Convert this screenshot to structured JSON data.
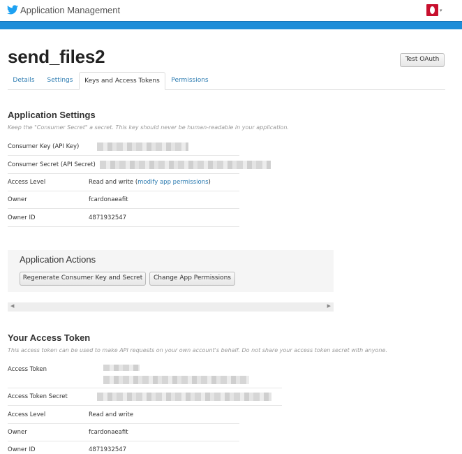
{
  "header": {
    "app_title": "Application Management",
    "logo_icon": "twitter-bird-icon",
    "avatar_icon": "user-avatar-icon",
    "caret": "▾"
  },
  "page": {
    "title": "send_files2",
    "test_oauth_label": "Test OAuth"
  },
  "tabs": [
    {
      "label": "Details",
      "active": false
    },
    {
      "label": "Settings",
      "active": false
    },
    {
      "label": "Keys and Access Tokens",
      "active": true
    },
    {
      "label": "Permissions",
      "active": false
    }
  ],
  "app_settings": {
    "heading": "Application Settings",
    "note": "Keep the \"Consumer Secret\" a secret. This key should never be human-readable in your application.",
    "rows": {
      "consumer_key": {
        "label": "Consumer Key (API Key)"
      },
      "consumer_secret": {
        "label": "Consumer Secret (API Secret)"
      },
      "access_level": {
        "label": "Access Level",
        "value_prefix": "Read and write (",
        "link": "modify app permissions",
        "value_suffix": ")"
      },
      "owner": {
        "label": "Owner",
        "value": "fcardonaeafit"
      },
      "owner_id": {
        "label": "Owner ID",
        "value": "4871932547"
      }
    }
  },
  "app_actions": {
    "heading": "Application Actions",
    "regenerate_label": "Regenerate Consumer Key and Secret",
    "change_permissions_label": "Change App Permissions"
  },
  "scrollbar": {
    "left_arrow": "◀",
    "right_arrow": "▶"
  },
  "access_token": {
    "heading": "Your Access Token",
    "note": "This access token can be used to make API requests on your own account's behalf. Do not share your access token secret with anyone.",
    "rows": {
      "token": {
        "label": "Access Token"
      },
      "secret": {
        "label": "Access Token Secret"
      },
      "access_level": {
        "label": "Access Level",
        "value": "Read and write"
      },
      "owner": {
        "label": "Owner",
        "value": "fcardonaeafit"
      },
      "owner_id": {
        "label": "Owner ID",
        "value": "4871932547"
      }
    }
  },
  "colors": {
    "accent_blue": "#1d8dd8",
    "link": "#2a7ab0",
    "avatar_red": "#c8102e"
  }
}
